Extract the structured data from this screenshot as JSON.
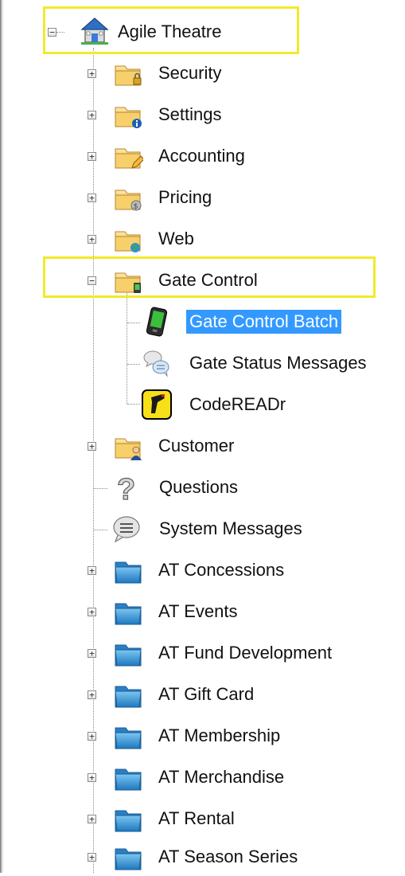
{
  "tree": {
    "root": {
      "label": "Agile Theatre",
      "icon": "house-icon",
      "expanded": true
    },
    "children": [
      {
        "label": "Security",
        "icon": "folder-lock-icon",
        "expanded": false
      },
      {
        "label": "Settings",
        "icon": "folder-info-icon",
        "expanded": false
      },
      {
        "label": "Accounting",
        "icon": "folder-pencil-icon",
        "expanded": false
      },
      {
        "label": "Pricing",
        "icon": "folder-coins-icon",
        "expanded": false
      },
      {
        "label": "Web",
        "icon": "folder-globe-icon",
        "expanded": false
      },
      {
        "label": "Gate Control",
        "icon": "folder-gate-icon",
        "expanded": true,
        "children": [
          {
            "label": "Gate Control Batch",
            "icon": "handheld-scanner-icon",
            "selected": true
          },
          {
            "label": "Gate Status Messages",
            "icon": "chat-bubbles-icon"
          },
          {
            "label": "CodeREADr",
            "icon": "barcode-scanner-icon"
          }
        ]
      },
      {
        "label": "Customer",
        "icon": "folder-user-icon",
        "expanded": false
      },
      {
        "label": "Questions",
        "icon": "question-icon"
      },
      {
        "label": "System Messages",
        "icon": "speech-bubble-icon"
      },
      {
        "label": "AT Concessions",
        "icon": "blue-folder-icon",
        "expanded": false
      },
      {
        "label": "AT Events",
        "icon": "blue-folder-icon",
        "expanded": false
      },
      {
        "label": "AT Fund Development",
        "icon": "blue-folder-icon",
        "expanded": false
      },
      {
        "label": "AT Gift Card",
        "icon": "blue-folder-icon",
        "expanded": false
      },
      {
        "label": "AT Membership",
        "icon": "blue-folder-icon",
        "expanded": false
      },
      {
        "label": "AT Merchandise",
        "icon": "blue-folder-icon",
        "expanded": false
      },
      {
        "label": "AT Rental",
        "icon": "blue-folder-icon",
        "expanded": false
      },
      {
        "label": "AT Season Series",
        "icon": "blue-folder-icon",
        "expanded": false
      }
    ]
  },
  "colors": {
    "selection": "#3399ff",
    "highlight_box": "#f2ea2a",
    "folder": "#f2c24e",
    "blue_folder": "#3f9ad6"
  }
}
